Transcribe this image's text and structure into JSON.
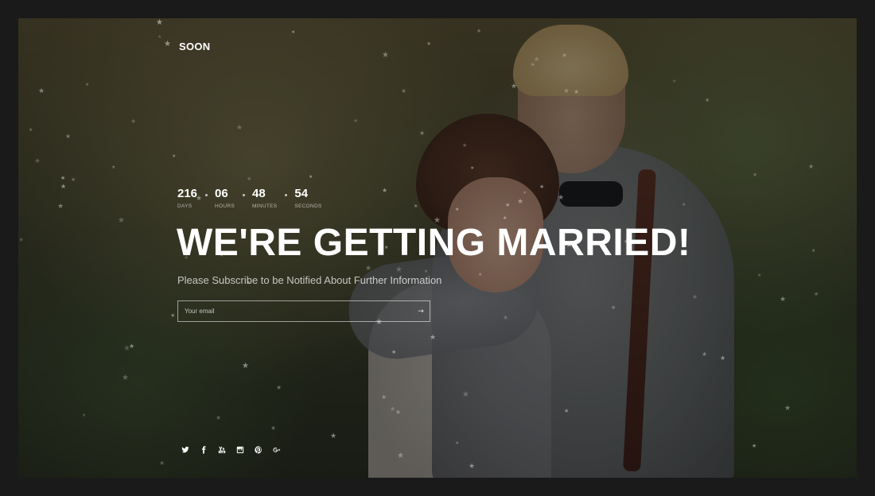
{
  "brand": {
    "logo": "SOON"
  },
  "countdown": [
    {
      "value": "216",
      "label": "DAYS"
    },
    {
      "value": "06",
      "label": "HOURS"
    },
    {
      "value": "48",
      "label": "MINUTES"
    },
    {
      "value": "54",
      "label": "SECONDS"
    }
  ],
  "hero": {
    "headline": "WE'RE GETTING MARRIED!",
    "subline": "Please Subscribe to be Notified About Further Information"
  },
  "subscribe": {
    "placeholder": "Your email",
    "submit_icon": "arrow-right-icon"
  },
  "social": [
    {
      "name": "twitter-icon"
    },
    {
      "name": "facebook-icon"
    },
    {
      "name": "youtube-icon"
    },
    {
      "name": "instagram-icon"
    },
    {
      "name": "pinterest-icon"
    },
    {
      "name": "google-plus-icon"
    }
  ],
  "colors": {
    "frame_background": "#1a1a1a",
    "text": "#ffffff"
  }
}
